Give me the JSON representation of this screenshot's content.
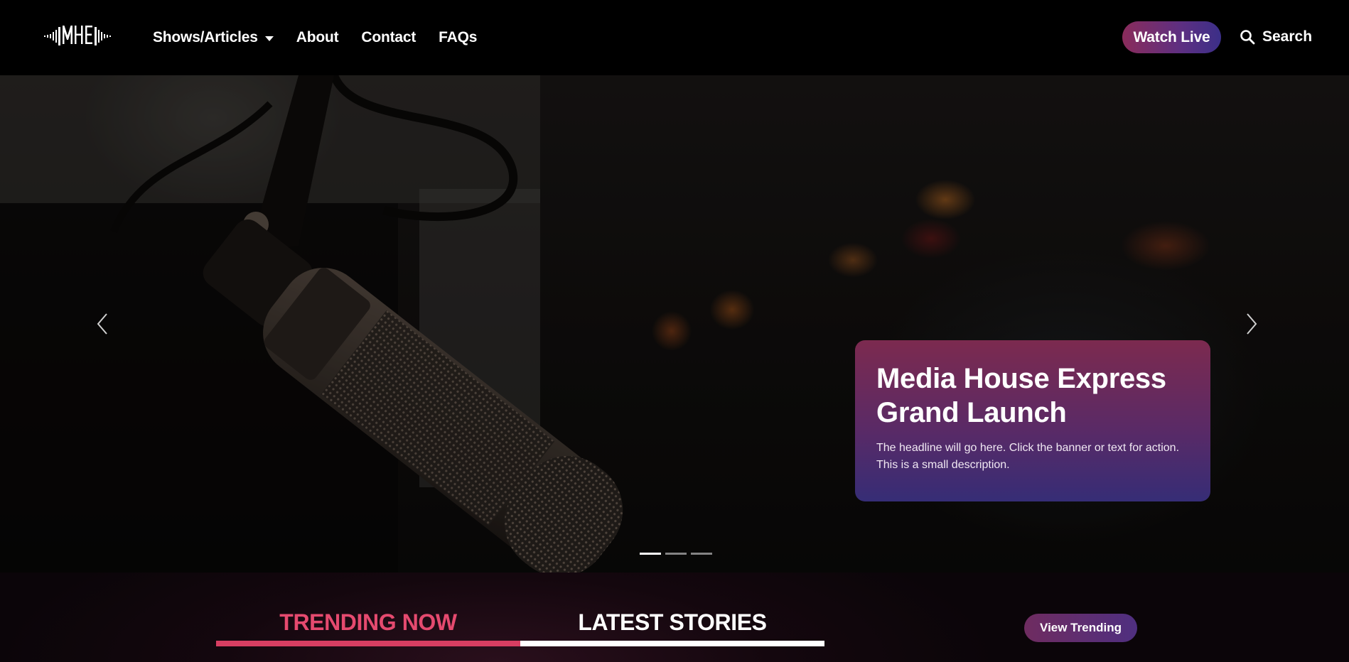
{
  "nav": {
    "logo_text": "MHE",
    "links": [
      {
        "label": "Shows/Articles",
        "has_dropdown": true
      },
      {
        "label": "About"
      },
      {
        "label": "Contact"
      },
      {
        "label": "FAQs"
      }
    ],
    "watch_live_label": "Watch Live",
    "search_label": "Search"
  },
  "hero": {
    "slide": {
      "title": "Media House Express Grand Launch",
      "description": "The headline will go here. Click the banner or text for action. This is a small description."
    },
    "slide_count": 3,
    "active_slide": 1,
    "icons": {
      "prev": "chevron-left-icon",
      "next": "chevron-right-icon"
    }
  },
  "sections": {
    "tabs": [
      {
        "label": "TRENDING NOW",
        "active": true
      },
      {
        "label": "LATEST STORIES",
        "active": false
      }
    ],
    "view_trending_label": "View Trending"
  },
  "colors": {
    "accent_pink": "#e54a6f",
    "gradient_start": "#8a2c5b",
    "gradient_end": "#3b2f88",
    "background": "#000000"
  }
}
